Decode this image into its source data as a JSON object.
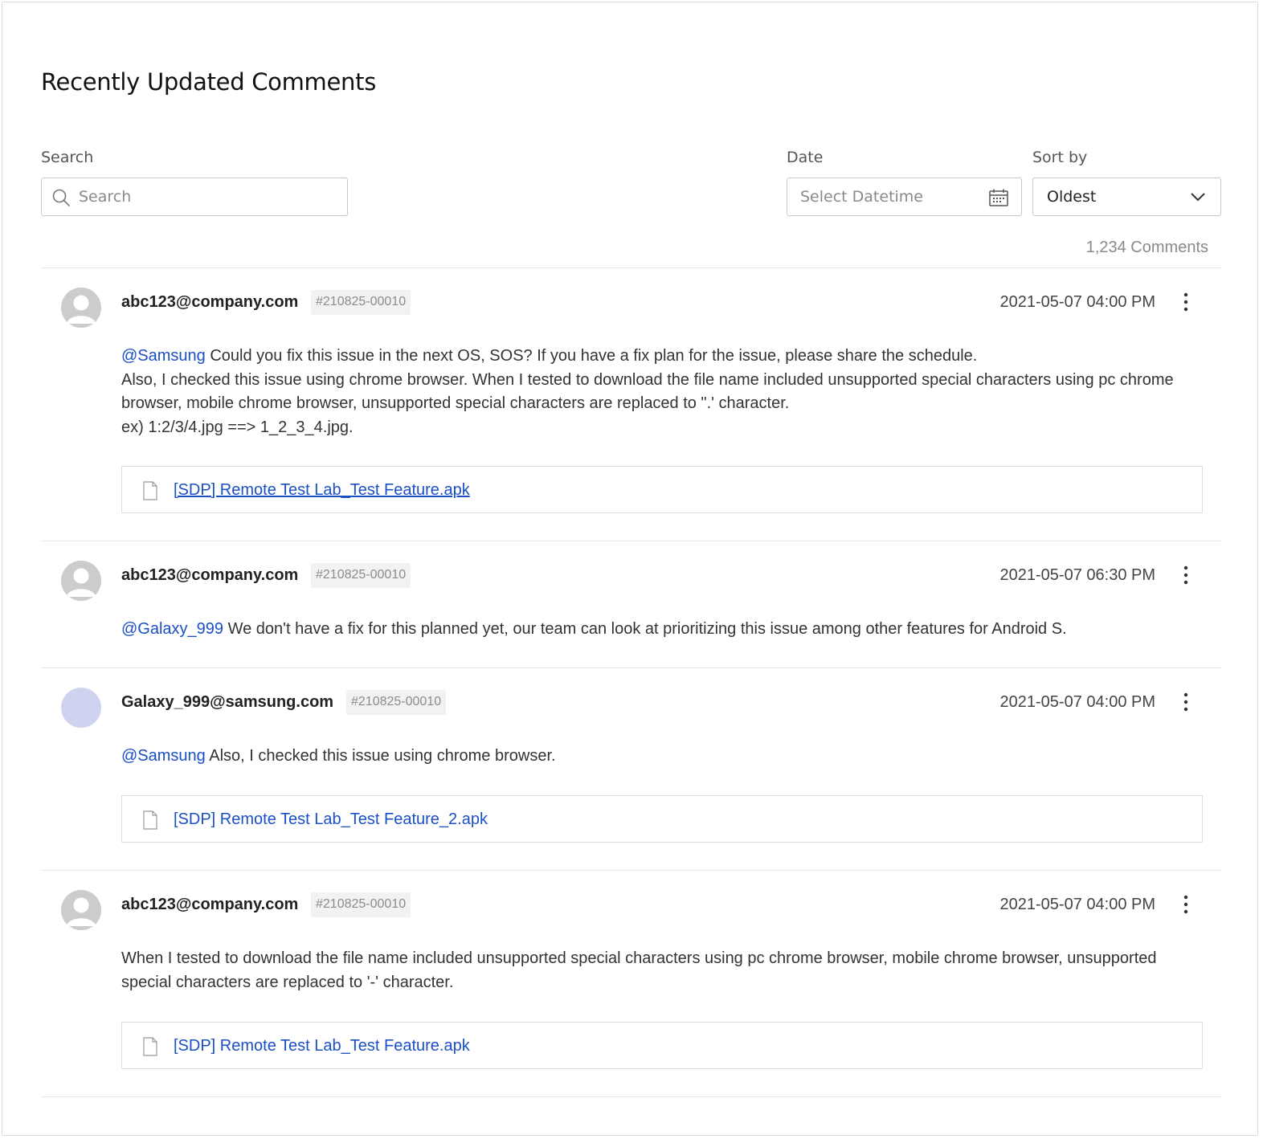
{
  "page": {
    "title": "Recently Updated Comments"
  },
  "filters": {
    "search": {
      "label": "Search",
      "placeholder": "Search",
      "icon": "search-icon"
    },
    "date": {
      "label": "Date",
      "placeholder": "Select Datetime",
      "icon": "calendar-icon"
    },
    "sort": {
      "label": "Sort by",
      "value": "Oldest",
      "icon": "chevron-down-icon"
    }
  },
  "comment_count": "1,234 Comments",
  "colors": {
    "link": "#1b4fc4",
    "mention": "#1b4fc4",
    "avatar_default": "#cccccc",
    "avatar_alt": "#cfd3ef"
  },
  "comments": [
    {
      "author": "abc123@company.com",
      "ticket": "#210825-00010",
      "timestamp": "2021-05-07 04:00 PM",
      "avatar": "default-user-avatar",
      "mention": "@Samsung",
      "lines": [
        "Could you fix this issue in the next OS, SOS? If you have a fix plan for the issue, please share the schedule.",
        "Also, I checked this issue using chrome browser. When I tested to download the file name included unsupported special characters using pc chrome browser, mobile chrome browser, unsupported special characters are replaced to \".' character.",
        "ex) 1:2/3/4.jpg ==> 1_2_3_4.jpg."
      ],
      "attachment": "[SDP] Remote Test Lab_Test Feature.apk"
    },
    {
      "author": "abc123@company.com",
      "ticket": "#210825-00010",
      "timestamp": "2021-05-07 06:30 PM",
      "avatar": "default-user-avatar",
      "mention": "@Galaxy_999",
      "lines": [
        "We don't have a fix for this planned yet, our team can look at prioritizing this issue among other features for Android S."
      ]
    },
    {
      "author": "Galaxy_999@samsung.com",
      "ticket": "#210825-00010",
      "timestamp": "2021-05-07 04:00 PM",
      "avatar": "color-avatar",
      "mention": "@Samsung",
      "lines": [
        "Also, I checked this issue using chrome browser."
      ],
      "attachment": "[SDP] Remote Test Lab_Test Feature_2.apk"
    },
    {
      "author": "abc123@company.com",
      "ticket": "#210825-00010",
      "timestamp": "2021-05-07 04:00 PM",
      "avatar": "default-user-avatar",
      "mention": "",
      "lines": [
        "When I tested to download the file name included unsupported special characters using pc chrome browser, mobile chrome browser, unsupported special characters are replaced to '-' character."
      ],
      "attachment": "[SDP] Remote Test Lab_Test Feature.apk"
    }
  ]
}
